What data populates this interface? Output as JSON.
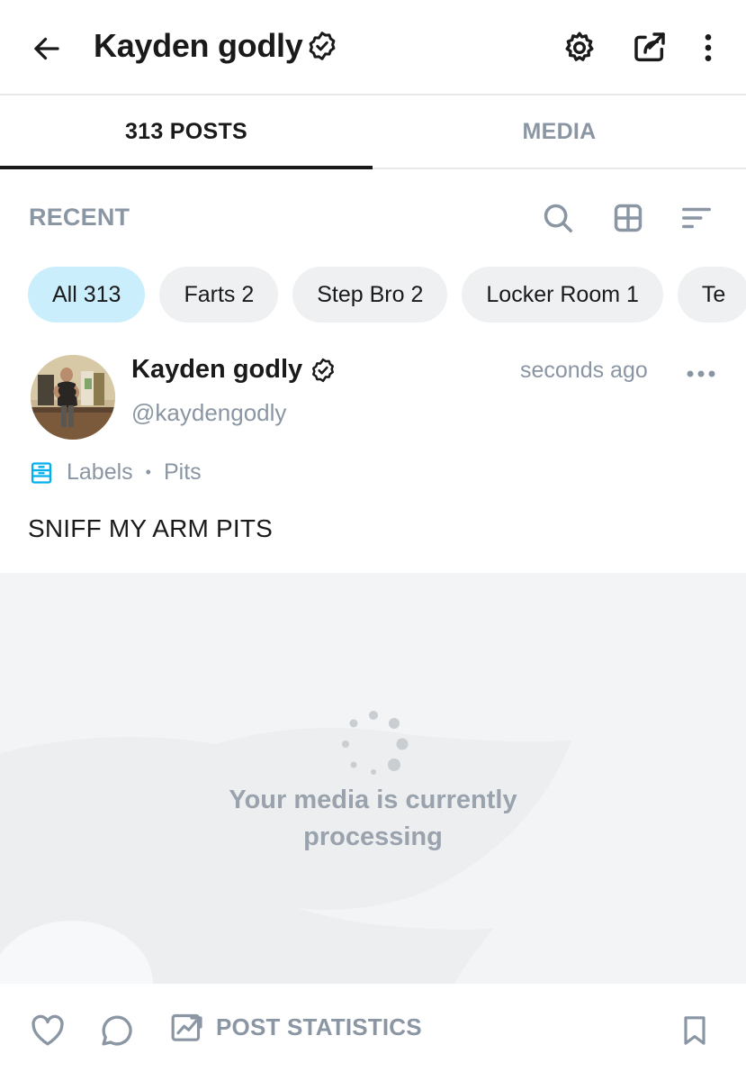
{
  "header": {
    "title": "Kayden godly",
    "icons": [
      "back-arrow-icon",
      "verified-icon",
      "settings-icon",
      "share-icon",
      "more-vertical-icon"
    ]
  },
  "tabs": [
    {
      "label": "313 POSTS",
      "active": true
    },
    {
      "label": "MEDIA",
      "active": false
    }
  ],
  "toolbar": {
    "label": "RECENT",
    "icons": [
      "search-icon",
      "grid-icon",
      "sort-icon"
    ]
  },
  "chips": [
    {
      "label": "All 313",
      "active": true
    },
    {
      "label": "Farts 2",
      "active": false
    },
    {
      "label": "Step Bro 2",
      "active": false
    },
    {
      "label": "Locker Room 1",
      "active": false
    },
    {
      "label": "Te",
      "active": false
    }
  ],
  "post": {
    "author_name": "Kayden godly",
    "handle": "@kaydengodly",
    "timestamp": "seconds ago",
    "labels_title": "Labels",
    "label": "Pits",
    "text": "SNIFF MY ARM PITS",
    "media_status_line1": "Your media is currently",
    "media_status_line2": "processing"
  },
  "actions": {
    "stats_label": "POST STATISTICS",
    "icons": [
      "heart-icon",
      "comment-icon",
      "statistics-icon",
      "bookmark-icon"
    ]
  },
  "colors": {
    "accent": "#00aff0",
    "active_chip": "#cbeefc",
    "muted_text": "#8a96a3",
    "chip_bg": "#eef0f2"
  }
}
